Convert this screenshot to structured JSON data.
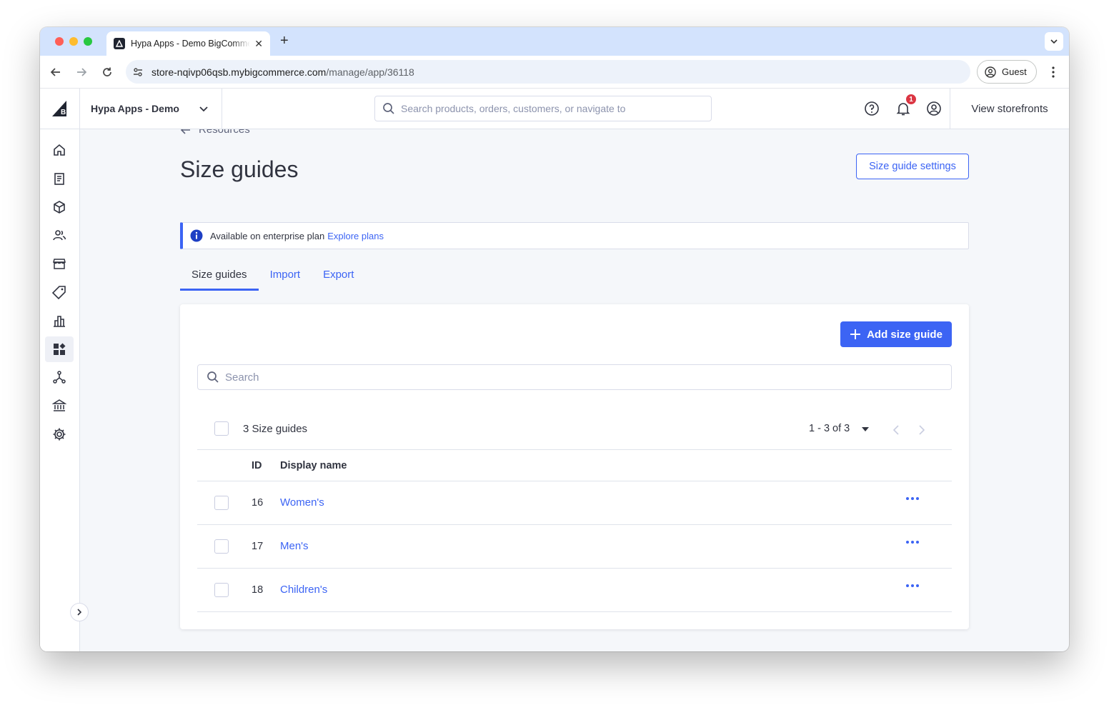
{
  "browser": {
    "tab_title": "Hypa Apps - Demo BigCommerce",
    "url_host": "store-nqivp06qsb.mybigcommerce.com",
    "url_path": "/manage/app/36118",
    "profile_label": "Guest"
  },
  "header": {
    "store_name": "Hypa Apps - Demo",
    "search_placeholder": "Search products, orders, customers, or navigate to",
    "notification_count": "1",
    "storefronts_label": "View storefronts"
  },
  "sidebar": {
    "items": [
      {
        "icon": "home-icon"
      },
      {
        "icon": "orders-icon"
      },
      {
        "icon": "products-icon"
      },
      {
        "icon": "customers-icon"
      },
      {
        "icon": "storefront-icon"
      },
      {
        "icon": "marketing-icon"
      },
      {
        "icon": "analytics-icon"
      },
      {
        "icon": "apps-icon",
        "active": true
      },
      {
        "icon": "channels-icon"
      },
      {
        "icon": "finance-icon"
      },
      {
        "icon": "settings-icon"
      }
    ]
  },
  "page": {
    "breadcrumb": "Resources",
    "title": "Size guides",
    "settings_button": "Size guide settings",
    "banner_text": "Available on enterprise plan",
    "banner_link": "Explore plans",
    "tabs": [
      {
        "label": "Size guides",
        "active": true
      },
      {
        "label": "Import"
      },
      {
        "label": "Export"
      }
    ],
    "add_button": "Add size guide",
    "search_placeholder": "Search",
    "summary": "3 Size guides",
    "pagination": "1 - 3 of 3",
    "columns": {
      "id": "ID",
      "name": "Display name"
    },
    "rows": [
      {
        "id": "16",
        "name": "Women's"
      },
      {
        "id": "17",
        "name": "Men's"
      },
      {
        "id": "18",
        "name": "Children's"
      }
    ]
  },
  "colors": {
    "accent": "#3c64f4",
    "text": "#313440",
    "badge": "#db3643",
    "background": "#f5f7fa"
  }
}
